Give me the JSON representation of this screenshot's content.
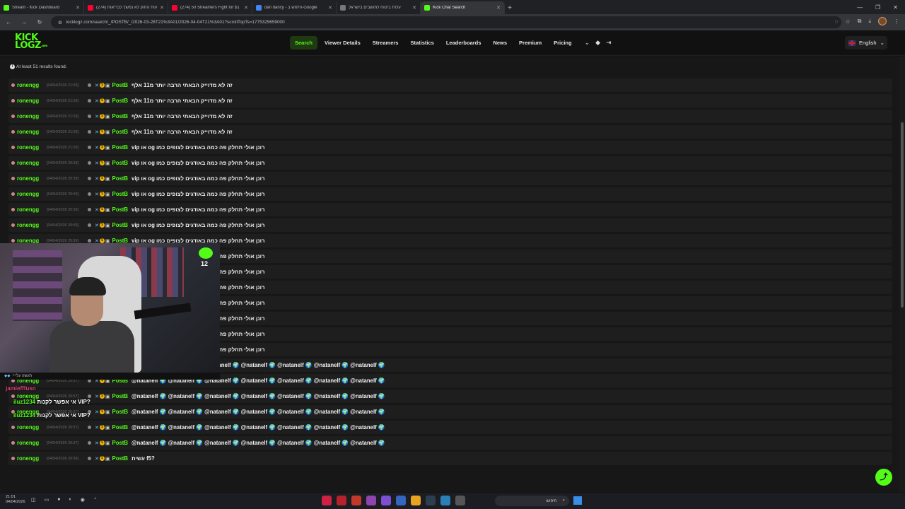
{
  "browser": {
    "tabs": [
      {
        "label": "Stream - Kick Dashboard",
        "color": "#53fc18"
      },
      {
        "label": "(274) באמצעות החוק לא נמשך לבריאות",
        "color": "#ff0033"
      },
      {
        "label": "(274) 50 Streamers Fight for $1",
        "color": "#ff0033"
      },
      {
        "label": "dan dancy - חיפוש ב-Google",
        "color": "#4285f4"
      },
      {
        "label": "עלות ביטוח לתושבים בישראל",
        "color": "#777777"
      },
      {
        "label": "Kick Chat Search",
        "color": "#53fc18"
      }
    ],
    "url": "kicklogz.com/search/_/POSTB/_/2026-03-28T21%3A01/2026-04-04T21%3A01?scrollTopTs=1775325659000"
  },
  "site": {
    "logo_top": "KICK",
    "logo_bottom": "LOGZ",
    "logo_suffix": ".com",
    "nav": [
      "Search",
      "Viewer Details",
      "Streamers",
      "Statistics",
      "Leaderboards",
      "News",
      "Premium",
      "Pricing"
    ],
    "language": "English",
    "results_text": "At least 51 results found."
  },
  "rows": [
    {
      "user": "ronengg",
      "ts": "[04/04/2026 21:03]",
      "channel": "PostB",
      "msg": "זה לא מדוייק הבאתי הרבה יותר מ11 אלף"
    },
    {
      "user": "ronengg",
      "ts": "[04/04/2026 21:03]",
      "channel": "PostB",
      "msg": "זה לא מדוייק הבאתי הרבה יותר מ11 אלף"
    },
    {
      "user": "ronengg",
      "ts": "[04/04/2026 21:03]",
      "channel": "PostB",
      "msg": "זה לא מדוייק הבאתי הרבה יותר מ11 אלף"
    },
    {
      "user": "ronengg",
      "ts": "[04/04/2026 21:03]",
      "channel": "PostB",
      "msg": "זה לא מדוייק הבאתי הרבה יותר מ11 אלף"
    },
    {
      "user": "ronengg",
      "ts": "[04/04/2026 21:03]",
      "channel": "PostB",
      "msg": "vip או og רונן אולי תחלק פה כמה באודגים לצופים כמו"
    },
    {
      "user": "ronengg",
      "ts": "[04/04/2026 20:59]",
      "channel": "PostB",
      "msg": "vip או og רונן אולי תחלק פה כמה באודגים לצופים כמו"
    },
    {
      "user": "ronengg",
      "ts": "[04/04/2026 20:59]",
      "channel": "PostB",
      "msg": "vip או og רונן אולי תחלק פה כמה באודגים לצופים כמו"
    },
    {
      "user": "ronengg",
      "ts": "[04/04/2026 20:59]",
      "channel": "PostB",
      "msg": "vip או og רונן אולי תחלק פה כמה באודגים לצופים כמו"
    },
    {
      "user": "ronengg",
      "ts": "[04/04/2026 20:59]",
      "channel": "PostB",
      "msg": "vip או og רונן אולי תחלק פה כמה באודגים לצופים כמו"
    },
    {
      "user": "ronengg",
      "ts": "[04/04/2026 20:59]",
      "channel": "PostB",
      "msg": "vip או og רונן אולי תחלק פה כמה באודגים לצופים כמו"
    },
    {
      "user": "ronengg",
      "ts": "[04/04/2026 20:59]",
      "channel": "PostB",
      "msg": "vip או og רונן אולי תחלק פה כמה באודגים לצופים כמו"
    },
    {
      "user": "ronengg",
      "ts": "[04/04/2026 20:59]",
      "channel": "PostB",
      "msg": "vip או og רונן אולי תחלק פה כמה באודגים לצופים כמו"
    },
    {
      "user": "ronengg",
      "ts": "[04/04/2026 20:59]",
      "channel": "PostB",
      "msg": "vip או og רונן אולי תחלק פה כמה באודגים לצופים כמו"
    },
    {
      "user": "ronengg",
      "ts": "[04/04/2026 20:59]",
      "channel": "PostB",
      "msg": "vip או og רונן אולי תחלק פה כמה באודגים לצופים כמו"
    },
    {
      "user": "ronengg",
      "ts": "[04/04/2026 20:59]",
      "channel": "PostB",
      "msg": "vip או og רונן אולי תחלק פה כמה באודגים לצופים כמו"
    },
    {
      "user": "ronengg",
      "ts": "[04/04/2026 20:59]",
      "channel": "PostB",
      "msg": "vip או og רונן אולי תחלק פה כמה באודגים לצופים כמו"
    },
    {
      "user": "ronengg",
      "ts": "[04/04/2026 20:59]",
      "channel": "PostB",
      "msg": "vip או og רונן אולי תחלק פה כמה באודגים לצופים כמו"
    },
    {
      "user": "ronengg",
      "ts": "[04/04/2026 20:59]",
      "channel": "PostB",
      "msg": "vip או og רונן אולי תחלק פה כמה באודגים לצופים כמו"
    },
    {
      "user": "ronengg",
      "ts": "[04/04/2026 20:57]",
      "channel": "PostB",
      "msg": "@natanelf 🌍 @natanelf 🌍 @natanelf 🌍 @natanelf 🌍 @natanelf 🌍 @natanelf 🌍 @natanelf 🌍"
    },
    {
      "user": "ronengg",
      "ts": "[04/04/2026 20:57]",
      "channel": "PostB",
      "msg": "@natanelf 🌍 @natanelf 🌍 @natanelf 🌍 @natanelf 🌍 @natanelf 🌍 @natanelf 🌍 @natanelf 🌍"
    },
    {
      "user": "ronengg",
      "ts": "[04/04/2026 20:57]",
      "channel": "PostB",
      "msg": "@natanelf 🌍 @natanelf 🌍 @natanelf 🌍 @natanelf 🌍 @natanelf 🌍 @natanelf 🌍 @natanelf 🌍"
    },
    {
      "user": "ronengg",
      "ts": "[04/04/2026 20:57]",
      "channel": "PostB",
      "msg": "@natanelf 🌍 @natanelf 🌍 @natanelf 🌍 @natanelf 🌍 @natanelf 🌍 @natanelf 🌍 @natanelf 🌍"
    },
    {
      "user": "ronengg",
      "ts": "[04/04/2026 20:57]",
      "channel": "PostB",
      "msg": "@natanelf 🌍 @natanelf 🌍 @natanelf 🌍 @natanelf 🌍 @natanelf 🌍 @natanelf 🌍 @natanelf 🌍"
    },
    {
      "user": "ronengg",
      "ts": "[04/04/2026 20:57]",
      "channel": "PostB",
      "msg": "@natanelf 🌍 @natanelf 🌍 @natanelf 🌍 @natanelf 🌍 @natanelf 🌍 @natanelf 🌍 @natanelf 🌍"
    },
    {
      "user": "ronengg",
      "ts": "[04/04/2026 20:56]",
      "channel": "PostB",
      "msg": "עשית f5?"
    }
  ],
  "overlay": {
    "emote_count": "12",
    "strip_text": "תעשה עליייי",
    "chat": [
      {
        "user": "jamiefffusn",
        "text": ""
      },
      {
        "user": "iluz1234",
        "text": "אי אפשר לקנות VIP?"
      },
      {
        "user": "iluz1234",
        "text": "אי אפשר לקנות VIP?"
      }
    ]
  },
  "taskbar": {
    "time": "21:01",
    "date": "04/04/2026",
    "search_label": "חיפוש"
  },
  "colors": {
    "accent": "#53fc18",
    "bg": "#171717",
    "row": "#1e1e1e"
  }
}
